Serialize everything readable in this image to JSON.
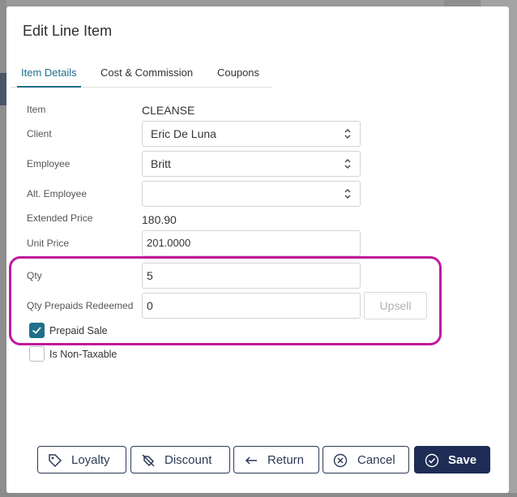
{
  "dialog": {
    "title": "Edit Line Item"
  },
  "tabs": [
    {
      "label": "Item Details",
      "active": true
    },
    {
      "label": "Cost & Commission",
      "active": false
    },
    {
      "label": "Coupons",
      "active": false
    }
  ],
  "fields": {
    "item": {
      "label": "Item",
      "value": "CLEANSE"
    },
    "client": {
      "label": "Client",
      "value": "Eric De Luna"
    },
    "employee": {
      "label": "Employee",
      "value": "Britt"
    },
    "alt_employee": {
      "label": "Alt. Employee",
      "value": ""
    },
    "extended_price": {
      "label": "Extended Price",
      "value": "180.90"
    },
    "unit_price": {
      "label": "Unit Price",
      "value": "201.0000"
    },
    "qty": {
      "label": "Qty",
      "value": "5"
    },
    "qty_prepaids_redeemed": {
      "label": "Qty Prepaids Redeemed",
      "value": "0"
    }
  },
  "upsell_label": "Upsell",
  "checkboxes": {
    "prepaid_sale": {
      "label": "Prepaid Sale",
      "checked": true
    },
    "non_taxable": {
      "label": "Is Non-Taxable",
      "checked": false
    }
  },
  "buttons": {
    "loyalty": "Loyalty",
    "discount": "Discount",
    "return": "Return",
    "cancel": "Cancel",
    "save": "Save"
  },
  "colors": {
    "accent": "#1f6f8b",
    "primary_button": "#1e2d55",
    "highlight": "#c0199c"
  }
}
